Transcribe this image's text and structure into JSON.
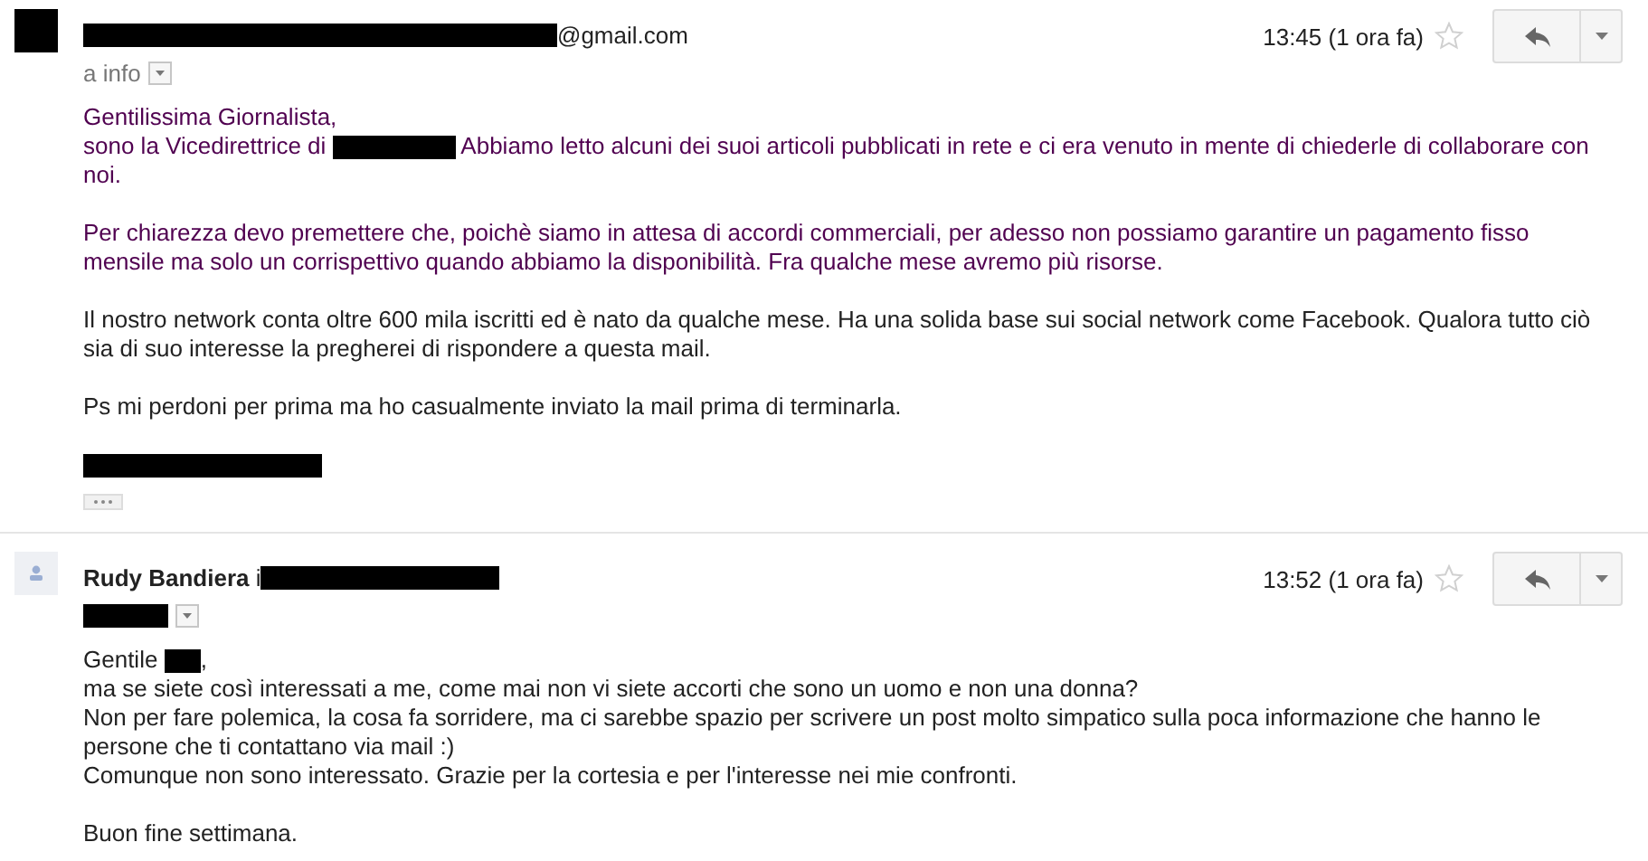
{
  "messages": [
    {
      "avatar": {
        "kind": "redacted"
      },
      "sender": [
        {
          "kind": "redacted_xl"
        },
        {
          "kind": "text",
          "text": "@gmail.com"
        }
      ],
      "recipient": [
        {
          "kind": "text",
          "text": "a info"
        }
      ],
      "time": "13:45 (1 ora fa)",
      "starred": false,
      "trimmed": true,
      "paragraphs": [
        {
          "color": "#500050",
          "lines": [
            [
              {
                "kind": "text",
                "text": "Gentilissima Giornalista,"
              }
            ],
            [
              {
                "kind": "text",
                "text": "sono la Vicedirettrice di "
              },
              {
                "kind": "redacted_m"
              },
              {
                "kind": "text",
                "text": " Abbiamo letto alcuni dei suoi articoli pubblicati in rete e ci era venuto in mente di chiederle di collaborare con"
              }
            ],
            [
              {
                "kind": "text",
                "text": "noi."
              }
            ]
          ]
        },
        {
          "color": "#500050",
          "lines": [
            [
              {
                "kind": "text",
                "text": "Per chiarezza devo premettere che, poichè siamo in attesa di accordi commerciali, per adesso non possiamo garantire un pagamento fisso"
              }
            ],
            [
              {
                "kind": "text",
                "text": "mensile ma solo un corrispettivo quando abbiamo la disponibilità. Fra qualche mese avremo più risorse."
              }
            ]
          ]
        },
        {
          "color": "#222222",
          "lines": [
            [
              {
                "kind": "text",
                "text": "Il nostro network conta oltre 600 mila iscritti ed è nato da qualche mese. Ha una solida base sui social network come Facebook. Qualora tutto ciò"
              }
            ],
            [
              {
                "kind": "text",
                "text": "sia di suo interesse la pregherei di rispondere a questa mail."
              }
            ]
          ]
        },
        {
          "color": "#222222",
          "lines": [
            [
              {
                "kind": "text",
                "text": "Ps mi perdoni per prima ma ho casualmente inviato la mail prima di terminarla."
              }
            ]
          ]
        },
        {
          "lines": [
            [
              {
                "kind": "redacted_l"
              }
            ]
          ]
        }
      ]
    },
    {
      "avatar": {
        "kind": "placeholder"
      },
      "sender": [
        {
          "kind": "name",
          "text": "Rudy Bandiera"
        },
        {
          "kind": "text",
          "text": " i"
        },
        {
          "kind": "redacted_l"
        }
      ],
      "recipient": [
        {
          "kind": "redacted_s"
        }
      ],
      "time": "13:52 (1 ora fa)",
      "starred": false,
      "paragraphs": [
        {
          "color": "#222222",
          "lines": [
            [
              {
                "kind": "text",
                "text": "Gentile "
              },
              {
                "kind": "redacted_xs"
              },
              {
                "kind": "text",
                "text": ","
              }
            ],
            [
              {
                "kind": "text",
                "text": "ma se siete così interessati a me, come mai non vi siete accorti che sono un uomo e non una donna?"
              }
            ],
            [
              {
                "kind": "text",
                "text": "Non per fare polemica, la cosa fa sorridere, ma ci sarebbe spazio per scrivere un post molto simpatico sulla poca informazione che hanno le"
              }
            ],
            [
              {
                "kind": "text",
                "text": "persone che ti contattano via mail :)"
              }
            ],
            [
              {
                "kind": "text",
                "text": "Comunque non sono interessato. Grazie per la cortesia e per l'interesse nei mie confronti."
              }
            ]
          ]
        },
        {
          "color": "#222222",
          "lines": [
            [
              {
                "kind": "text",
                "text": "Buon fine settimana."
              }
            ]
          ]
        }
      ]
    }
  ]
}
